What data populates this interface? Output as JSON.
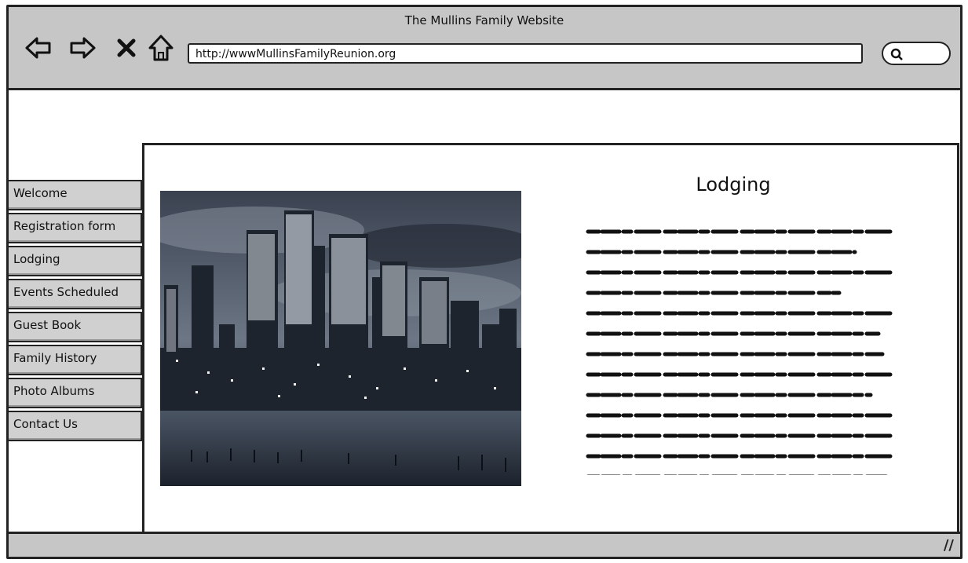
{
  "window": {
    "title": "The Mullins Family Website"
  },
  "toolbar": {
    "back_icon": "back-arrow-icon",
    "forward_icon": "forward-arrow-icon",
    "stop_icon": "close-icon",
    "home_icon": "home-icon",
    "url": "http://wwwMullinsFamilyReunion.org",
    "search_icon": "search-icon"
  },
  "sidebar": {
    "items": [
      {
        "label": "Welcome"
      },
      {
        "label": "Registration form"
      },
      {
        "label": "Lodging"
      },
      {
        "label": "Events Scheduled"
      },
      {
        "label": "Guest Book"
      },
      {
        "label": "Family History"
      },
      {
        "label": "Photo Albums"
      },
      {
        "label": "Contact Us"
      }
    ]
  },
  "main": {
    "heading": "Lodging",
    "image_alt_icon": "city-skyline-image"
  },
  "colors": {
    "chrome": "#c6c6c6",
    "sidebar": "#d0d0d0",
    "ink": "#222222"
  }
}
